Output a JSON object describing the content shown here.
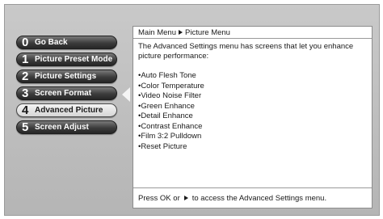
{
  "menu": {
    "items": [
      {
        "number": "0",
        "label": "Go Back"
      },
      {
        "number": "1",
        "label": "Picture Preset Mode"
      },
      {
        "number": "2",
        "label": "Picture Settings"
      },
      {
        "number": "3",
        "label": "Screen Format"
      },
      {
        "number": "4",
        "label": "Advanced Picture"
      },
      {
        "number": "5",
        "label": "Screen Adjust"
      }
    ]
  },
  "panel": {
    "breadcrumb": {
      "root": "Main Menu",
      "current": "Picture Menu"
    },
    "description": "The Advanced Settings menu has screens that let you enhance picture performance:",
    "features": [
      "•Auto Flesh Tone",
      "•Color Temperature",
      "•Video Noise Filter",
      "•Green Enhance",
      "•Detail Enhance",
      "•Contrast Enhance",
      "•Film 3:2 Pulldown",
      "•Reset Picture"
    ],
    "footer": {
      "before": "Press OK or",
      "after": "to access the Advanced Settings menu."
    }
  }
}
